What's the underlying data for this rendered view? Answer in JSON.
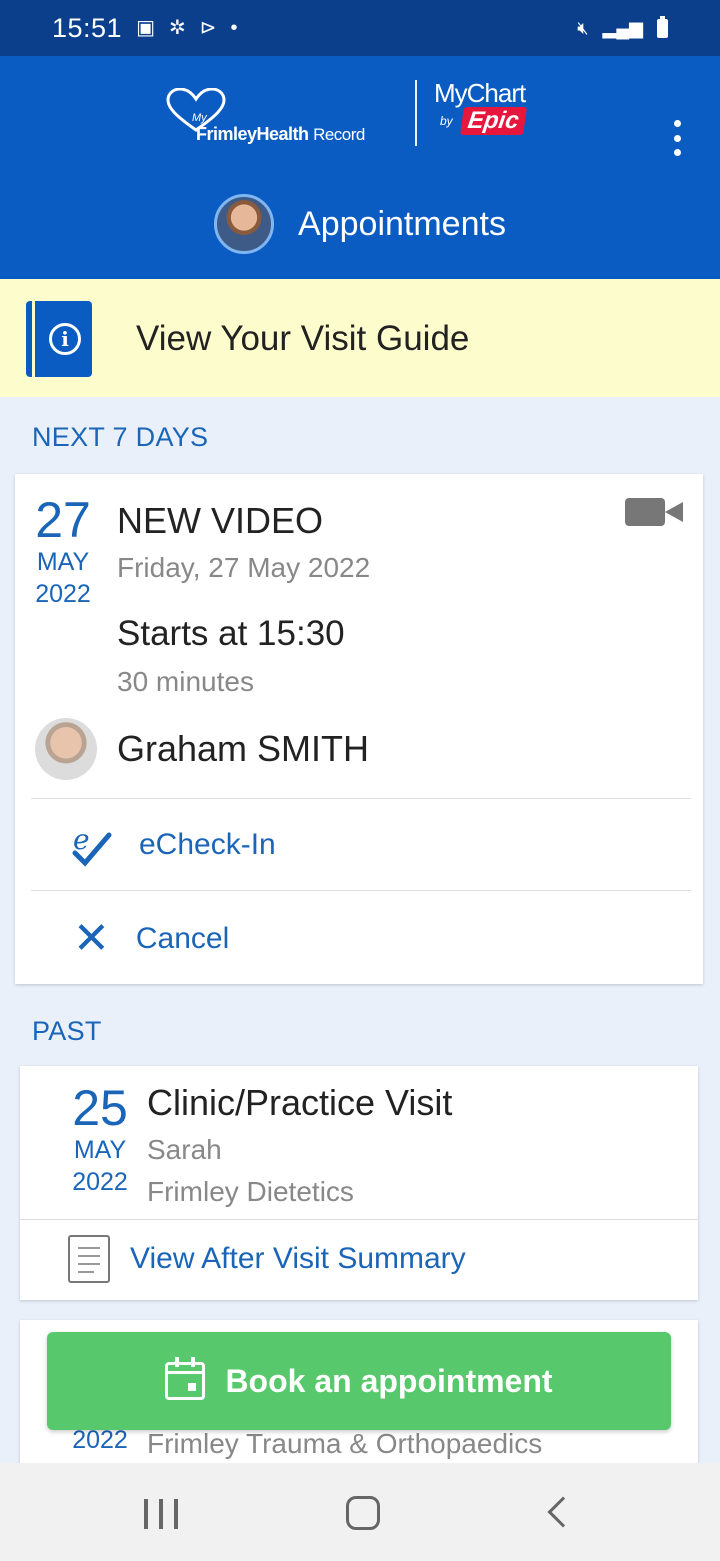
{
  "status_bar": {
    "time": "15:51"
  },
  "header": {
    "logo_my": "My",
    "logo_brand": "FrimleyHealth",
    "logo_record": "Record",
    "mychart_logo": "MyChart",
    "mychart_by": "by",
    "epic_logo": "Epic",
    "title": "Appointments"
  },
  "guide_banner": {
    "label": "View Your Visit Guide"
  },
  "upcoming": {
    "section_label": "NEXT 7 DAYS",
    "appointment": {
      "day": "27",
      "month": "MAY",
      "year": "2022",
      "title": "NEW VIDEO",
      "date_text": "Friday, 27 May 2022",
      "start_text": "Starts at 15:30",
      "duration": "30 minutes",
      "provider": "Graham SMITH",
      "echeckin_label": "eCheck-In",
      "cancel_label": "Cancel"
    }
  },
  "past": {
    "section_label": "PAST",
    "appointment": {
      "day": "25",
      "month": "MAY",
      "year": "2022",
      "title": "Clinic/Practice Visit",
      "provider": "Sarah",
      "department": "Frimley Dietetics",
      "summary_label": "View After Visit Summary"
    },
    "next_partial": {
      "year": "2022",
      "department": "Frimley Trauma & Orthopaedics"
    }
  },
  "book_button": {
    "label": "Book an appointment"
  },
  "colors": {
    "header_blue": "#0b5cc2",
    "status_blue": "#0b3f8c",
    "link_blue": "#1a65b8",
    "book_green": "#57c96c",
    "banner_yellow": "#fcfccc"
  }
}
